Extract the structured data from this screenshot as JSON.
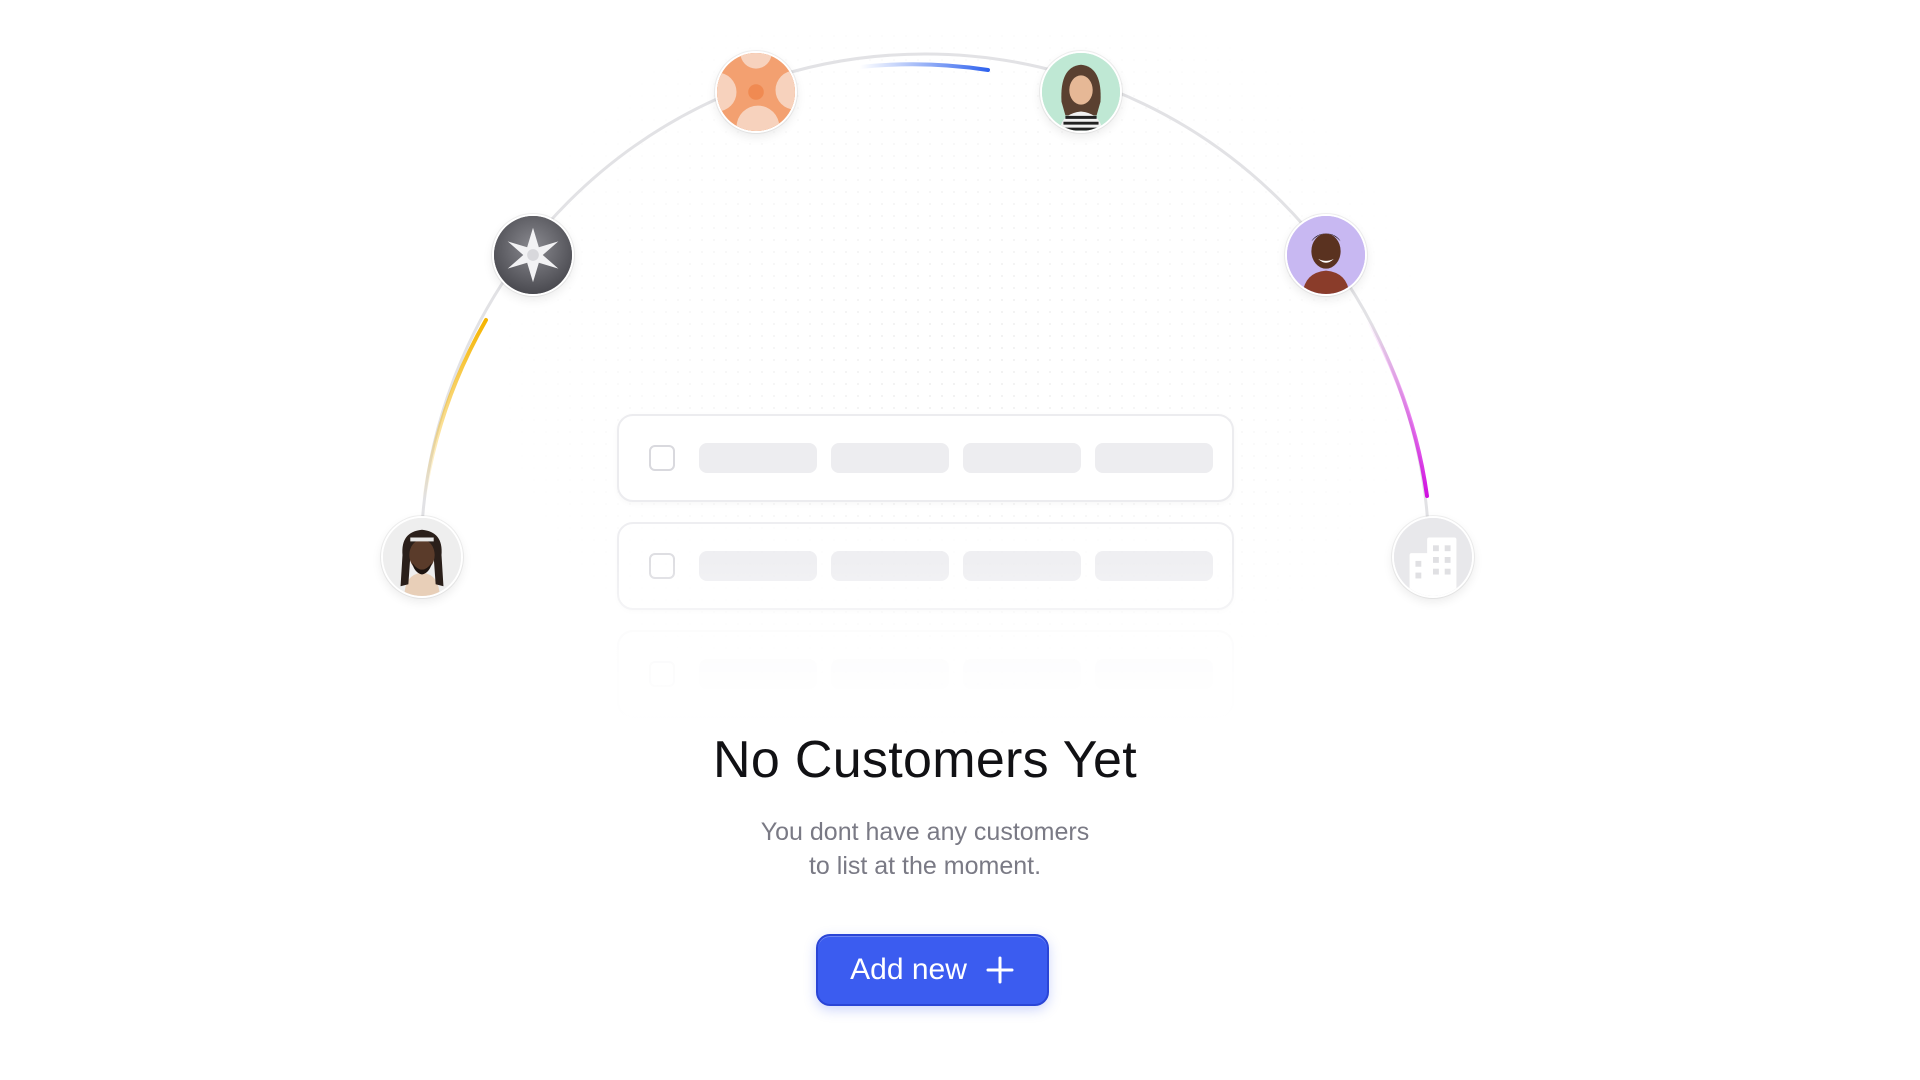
{
  "empty_state": {
    "title": "No Customers Yet",
    "subtitle_line1": "You dont have any customers",
    "subtitle_line2": "to list at the moment.",
    "add_button_label": "Add new",
    "add_button_icon": "plus-icon"
  },
  "avatars": [
    {
      "name": "avatar-person-dreadlocks",
      "kind": "photo"
    },
    {
      "name": "avatar-brand-star-logo",
      "kind": "logo"
    },
    {
      "name": "avatar-brand-orange-logo",
      "kind": "logo"
    },
    {
      "name": "avatar-person-woman",
      "kind": "photo"
    },
    {
      "name": "avatar-person-man-smiling",
      "kind": "photo"
    },
    {
      "name": "avatar-building-icon",
      "kind": "icon"
    }
  ],
  "placeholder_rows": 3,
  "colors": {
    "accent": "#3b5cf0",
    "arc": "#e3e3e6",
    "arc_blue": "#3b6cf0",
    "arc_yellow": "#f5b400",
    "arc_magenta": "#e020e8"
  }
}
